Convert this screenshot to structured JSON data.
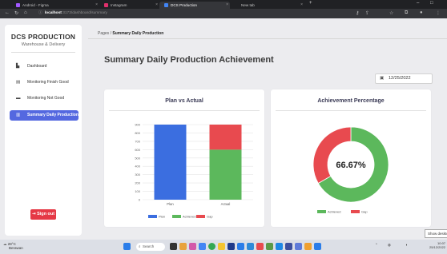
{
  "browser": {
    "tabs": [
      {
        "label": "Android - Figma",
        "color": "#a259ff"
      },
      {
        "label": "Instagram",
        "color": "#e1306c"
      },
      {
        "label": "DCS Production",
        "color": "#4285f4"
      },
      {
        "label": "New tab",
        "color": "#777777"
      }
    ],
    "url_host": "localhost",
    "url_path": ":3173/dashboard/summary"
  },
  "sidebar": {
    "brand": "DCS PRODUCTION",
    "subtitle": "Warehouse & Delivery",
    "items": [
      {
        "label": "Dashboard",
        "icon": "dashboard-icon"
      },
      {
        "label": "Monitoring Finish Good",
        "icon": "document-icon"
      },
      {
        "label": "Monitoring Not Good",
        "icon": "card-icon"
      },
      {
        "label": "Summary Daily Production",
        "icon": "chart-icon"
      }
    ],
    "signout_label": "Sign out"
  },
  "breadcrumb": {
    "root": "Pages",
    "separator": "/",
    "current": "Summary Daily Production"
  },
  "main": {
    "title": "Summary Daily Production Achievement",
    "date": "12/25/2022"
  },
  "colors": {
    "plan": "#3b6ee0",
    "achieved": "#5cb85c",
    "gap": "#e84a4f",
    "accent": "#5468e0",
    "signout": "#e53946"
  },
  "chart_data": [
    {
      "type": "bar",
      "title": "Plan vs Actual",
      "categories": [
        "Plan",
        "Actual"
      ],
      "ylim": [
        0,
        900
      ],
      "yticks": [
        "0",
        "100",
        "200",
        "300",
        "400",
        "500",
        "600",
        "700",
        "800",
        "900"
      ],
      "series": [
        {
          "name": "Plan",
          "values": [
            900,
            0
          ]
        },
        {
          "name": "Achieved",
          "values": [
            0,
            600
          ]
        },
        {
          "name": "Gap",
          "values": [
            0,
            300
          ]
        }
      ],
      "stacked": true,
      "grid": true,
      "legend": "bottom"
    },
    {
      "type": "pie",
      "title": "Achievement Percentage",
      "center_label": "66.67%",
      "labels": [
        "Achieved",
        "Gap"
      ],
      "values": [
        66.67,
        33.33
      ],
      "legend": "bottom"
    }
  ],
  "taskbar": {
    "weather_temp": "28°C",
    "weather_desc": "Berawan",
    "search_label": "Search",
    "time": "10:07",
    "date": "25/12/2022",
    "tooltip": "Show desktop"
  }
}
